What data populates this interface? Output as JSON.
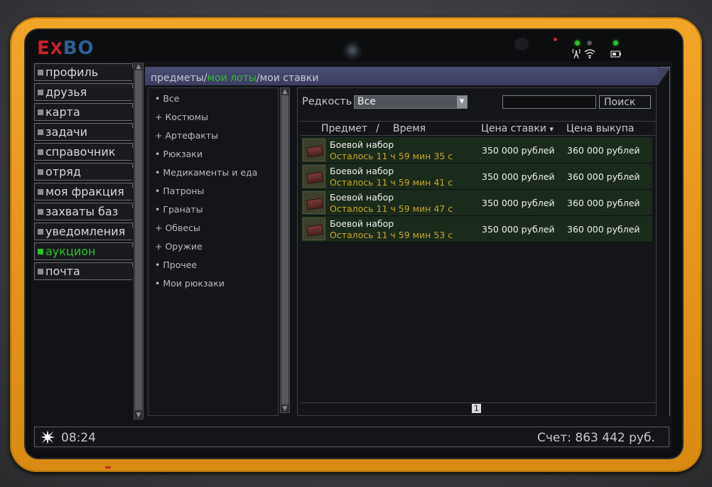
{
  "brand": {
    "logo_left": "E",
    "logo_mid": "X",
    "logo_right": "BO"
  },
  "status_icons": {
    "signal": "signal-tower-icon",
    "wifi": "wifi-icon",
    "battery": "battery-icon",
    "led_color": "#2ec12e"
  },
  "sidebar": {
    "items": [
      {
        "label": "профиль"
      },
      {
        "label": "друзья"
      },
      {
        "label": "карта"
      },
      {
        "label": "задачи"
      },
      {
        "label": "справочник"
      },
      {
        "label": "отряд"
      },
      {
        "label": "моя фракция"
      },
      {
        "label": "захваты баз"
      },
      {
        "label": "уведомления"
      },
      {
        "label": "аукцион",
        "active": true
      },
      {
        "label": "почта"
      }
    ]
  },
  "breadcrumb": {
    "items": [
      "предметы",
      "мои лоты",
      "мои ставки"
    ],
    "sep": "/",
    "active_index": 1
  },
  "categories": [
    {
      "prefix": "•",
      "label": "Все"
    },
    {
      "prefix": "+",
      "label": "Костюмы"
    },
    {
      "prefix": "+",
      "label": "Артефакты"
    },
    {
      "prefix": "•",
      "label": "Рюкзаки"
    },
    {
      "prefix": "•",
      "label": "Медикаменты и еда"
    },
    {
      "prefix": "•",
      "label": "Патроны"
    },
    {
      "prefix": "•",
      "label": "Гранаты"
    },
    {
      "prefix": "+",
      "label": "Обвесы"
    },
    {
      "prefix": "+",
      "label": "Оружие"
    },
    {
      "prefix": "•",
      "label": "Прочее"
    },
    {
      "prefix": "•",
      "label": "Мои рюкзаки"
    }
  ],
  "filter": {
    "rarity_label": "Редкость",
    "rarity_value": "Все",
    "search_value": "",
    "search_button": "Поиск"
  },
  "table": {
    "headers": {
      "item": "Предмет",
      "sep": "/",
      "time": "Время",
      "bid": "Цена ставки",
      "bid_sort": "▾",
      "buyout": "Цена выкупа"
    },
    "rows": [
      {
        "name": "Боевой набор",
        "time": "Осталось 11 ч 59 мин 35 с",
        "bid": "350 000 рублей",
        "buyout": "360 000 рублей"
      },
      {
        "name": "Боевой набор",
        "time": "Осталось 11 ч 59 мин 41 с",
        "bid": "350 000 рублей",
        "buyout": "360 000 рублей"
      },
      {
        "name": "Боевой набор",
        "time": "Осталось 11 ч 59 мин 47 с",
        "bid": "350 000 рублей",
        "buyout": "360 000 рублей"
      },
      {
        "name": "Боевой набор",
        "time": "Осталось 11 ч 59 мин 53 с",
        "bid": "350 000 рублей",
        "buyout": "360 000 рублей"
      }
    ]
  },
  "pagination": {
    "current": "1"
  },
  "footer": {
    "time": "08:24",
    "balance": "Счет: 863 442 руб."
  }
}
